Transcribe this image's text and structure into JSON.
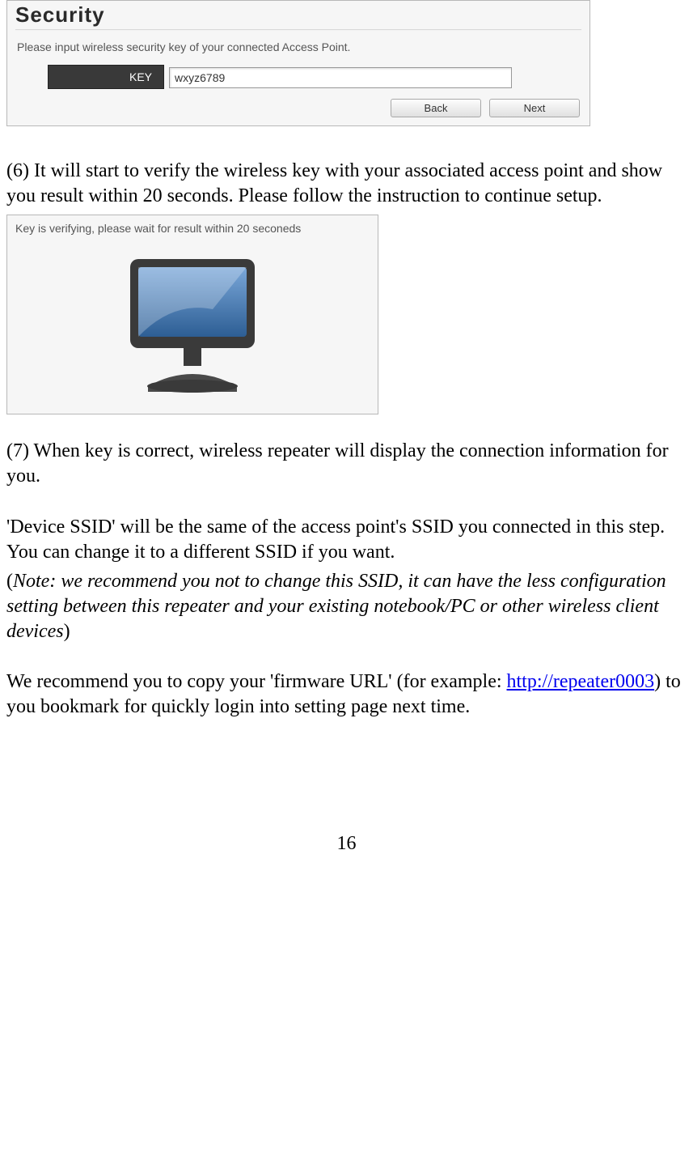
{
  "shot1": {
    "title": "Security",
    "subtitle": "Please input wireless security key of your connected Access Point.",
    "key_label": "KEY",
    "key_value": "wxyz6789",
    "back": "Back",
    "next": "Next"
  },
  "para6": "(6) It will start to verify the wireless key with your associated access point and show you result within 20 seconds. Please follow the instruction to continue setup.",
  "shot2": {
    "subtitle": "Key is verifying, please wait for result within 20 seconeds"
  },
  "para7": "(7) When key is correct, wireless repeater will display the connection information for you.",
  "ssid_para": "'Device SSID' will be the same of the access point's SSID you connected in this step. You can change it to a different SSID if you want.",
  "note_open": "(",
  "note_italic": "Note: we recommend you not to change this SSID, it can have the less configuration setting between this repeater and your existing notebook/PC or other wireless client devices",
  "note_close": ")",
  "fw_pre": "We recommend you to copy your 'firmware URL' (for example: ",
  "fw_link": "http://repeater0003",
  "fw_post": ") to you bookmark for quickly login into setting page next time.",
  "page_number": "16"
}
